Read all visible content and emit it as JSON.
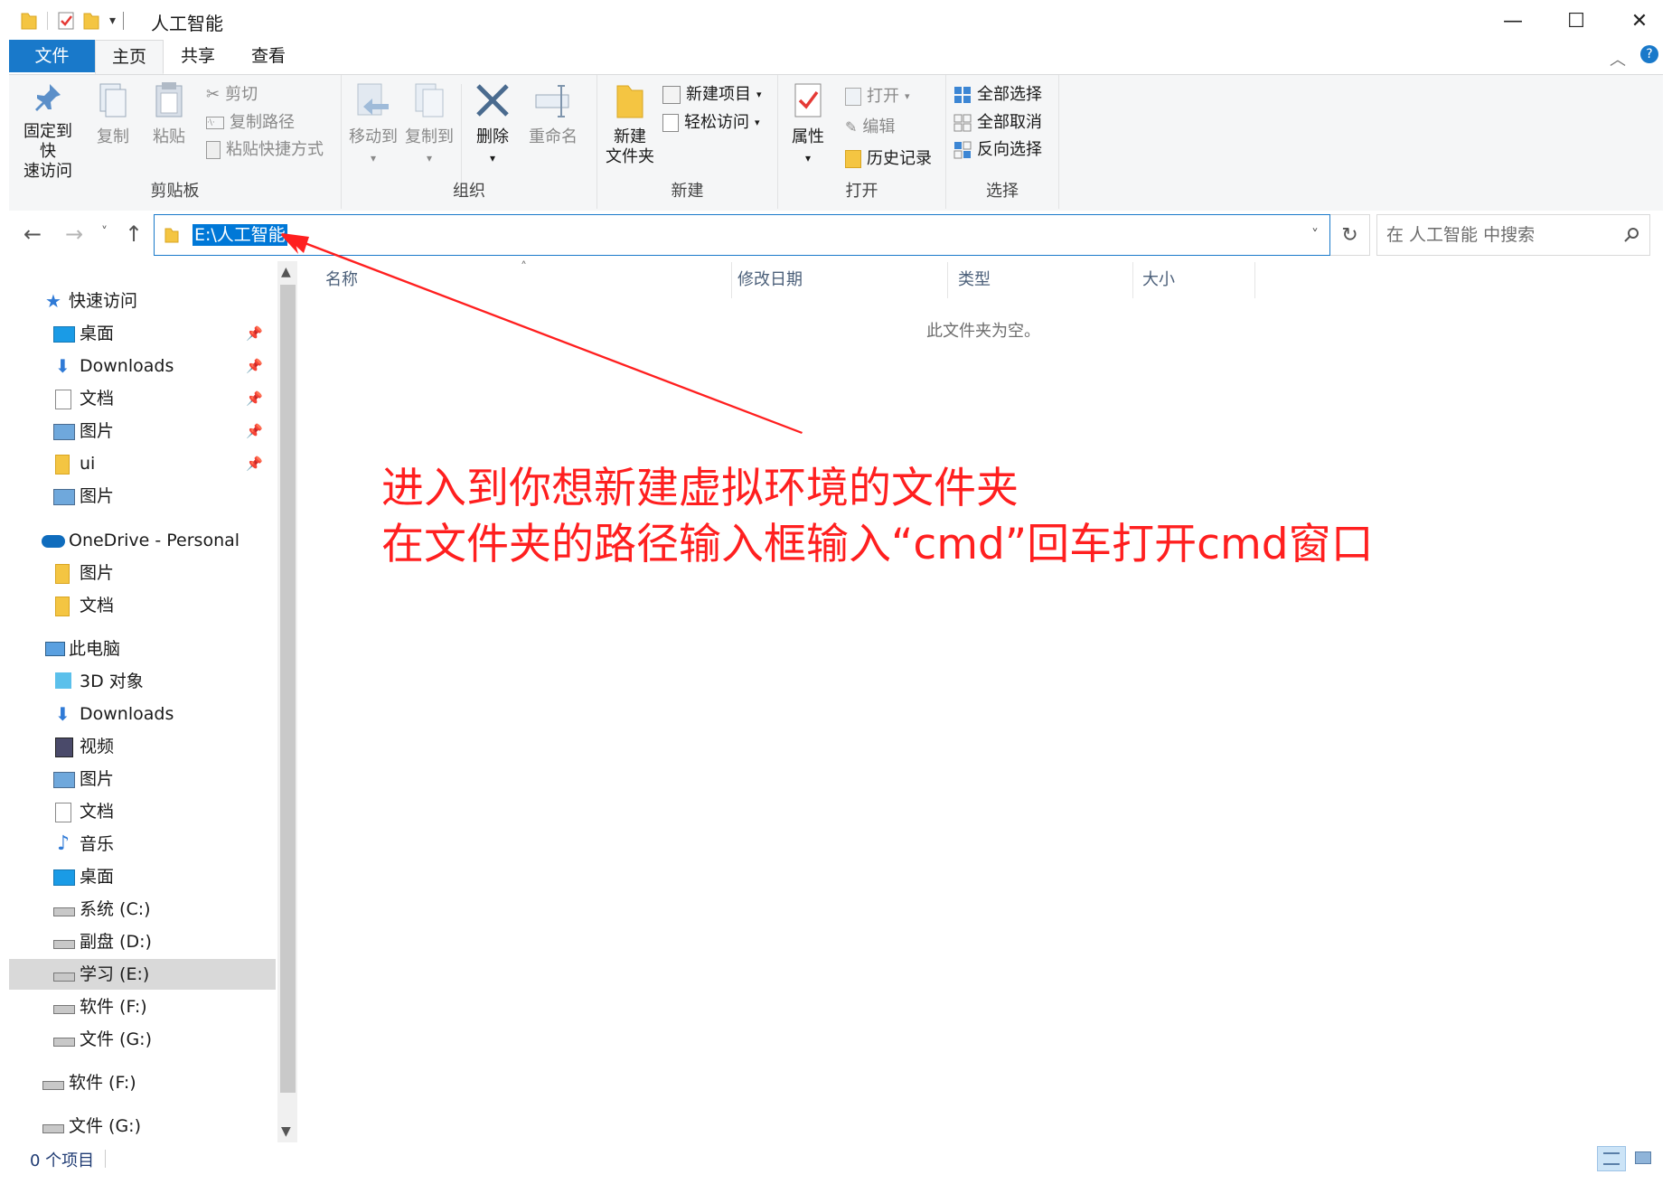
{
  "window": {
    "title": "人工智能",
    "controls": {
      "minimize": "—",
      "maximize": "☐",
      "close": "✕"
    }
  },
  "tabs": [
    {
      "label": "文件"
    },
    {
      "label": "主页"
    },
    {
      "label": "共享"
    },
    {
      "label": "查看"
    }
  ],
  "ribbon": {
    "clipboard": {
      "group_label": "剪贴板",
      "pin_line1": "固定到快",
      "pin_line2": "速访问",
      "copy": "复制",
      "paste": "粘贴",
      "cut": "剪切",
      "copy_path": "复制路径",
      "paste_shortcut": "粘贴快捷方式"
    },
    "organize": {
      "group_label": "组织",
      "move_to": "移动到",
      "copy_to": "复制到",
      "delete": "删除",
      "rename": "重命名"
    },
    "new": {
      "group_label": "新建",
      "new_folder_line1": "新建",
      "new_folder_line2": "文件夹",
      "new_item": "新建项目",
      "easy_access": "轻松访问"
    },
    "open": {
      "group_label": "打开",
      "properties": "属性",
      "open": "打开",
      "edit": "编辑",
      "history": "历史记录"
    },
    "select": {
      "group_label": "选择",
      "select_all": "全部选择",
      "select_none": "全部取消",
      "invert": "反向选择"
    }
  },
  "address": {
    "path": "E:\\人工智能",
    "search_placeholder": "在 人工智能 中搜索"
  },
  "nav": {
    "quick_access": "快速访问",
    "qa_items": [
      "桌面",
      "Downloads",
      "文档",
      "图片",
      "ui",
      "图片"
    ],
    "onedrive": "OneDrive - Personal",
    "od_items": [
      "图片",
      "文档"
    ],
    "this_pc": "此电脑",
    "pc_items": [
      "3D 对象",
      "Downloads",
      "视频",
      "图片",
      "文档",
      "音乐",
      "桌面",
      "系统 (C:)",
      "副盘 (D:)",
      "学习 (E:)",
      "软件 (F:)",
      "文件 (G:)"
    ],
    "extra_drives": [
      "软件 (F:)",
      "文件 (G:)"
    ]
  },
  "columns": [
    "名称",
    "修改日期",
    "类型",
    "大小"
  ],
  "empty_message": "此文件夹为空。",
  "annotation": {
    "line1": "进入到你想新建虚拟环境的文件夹",
    "line2": "在文件夹的路径输入框输入“cmd”回车打开cmd窗口",
    "color": "#ff1f1f"
  },
  "status": {
    "item_count": "0 个项目"
  },
  "colors": {
    "accent": "#1979ca",
    "selection": "#0078d7"
  }
}
